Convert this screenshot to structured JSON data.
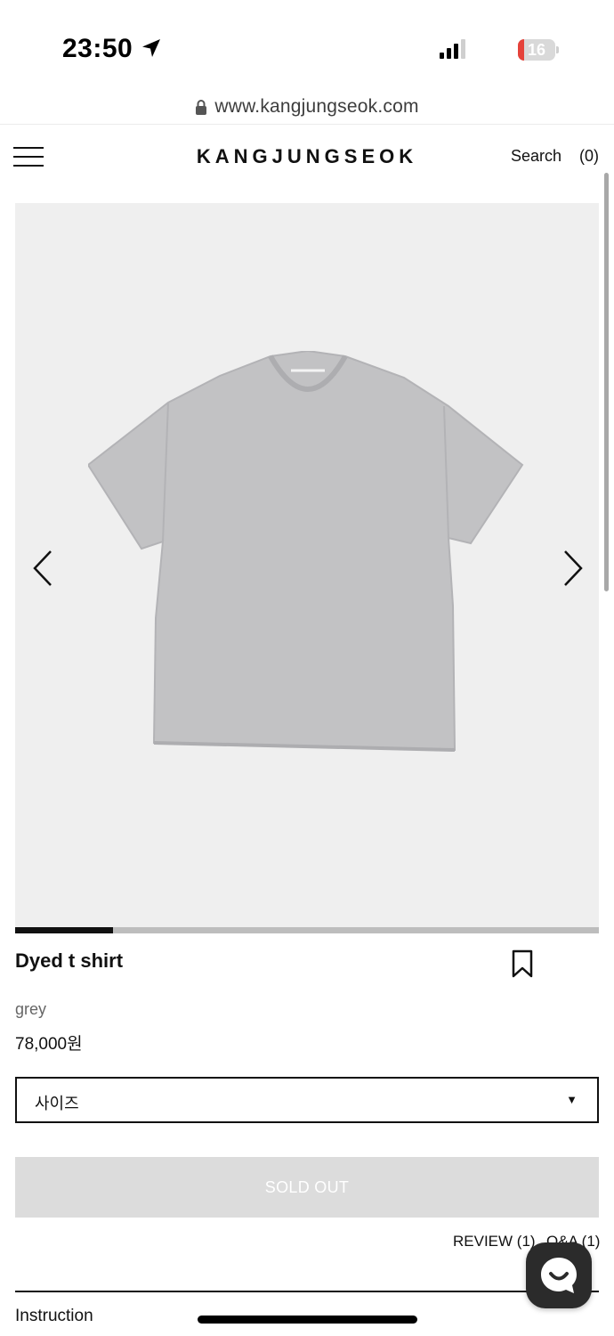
{
  "status_bar": {
    "time": "23:50",
    "battery_level": "16",
    "battery_fraction": 0.16,
    "battery_color": "#e5423a",
    "icons": [
      "location-arrow-icon",
      "signal-icon",
      "battery-icon"
    ]
  },
  "browser": {
    "url": "www.kangjungseok.com",
    "icon": "lock-icon"
  },
  "header": {
    "logo": "KANGJUNGSEOK",
    "search_label": "Search",
    "cart_label": "(0)",
    "menu_icon": "hamburger-menu-icon"
  },
  "gallery": {
    "image_alt": "grey t shirt",
    "progress_fraction": 0.167,
    "prev_icon": "chevron-left-icon",
    "next_icon": "chevron-right-icon"
  },
  "product": {
    "name": "Dyed t shirt",
    "color": "grey",
    "price": "78,000원",
    "bookmark_icon": "bookmark-icon"
  },
  "size_select": {
    "label": "사이즈",
    "caret": "▼"
  },
  "actions": {
    "sold_out_label": "SOLD OUT"
  },
  "tabs": {
    "review": "REVIEW (1)",
    "qna": "Q&A (1)"
  },
  "sections": {
    "instruction": "Instruction"
  },
  "chat": {
    "icon": "chat-bubble-icon"
  },
  "colors": {
    "background": "#ffffff",
    "text": "#111111",
    "gallery_bg": "#efefef",
    "sold_out_bg": "#dcdcdc",
    "chat_bg": "#2b2b2b"
  }
}
